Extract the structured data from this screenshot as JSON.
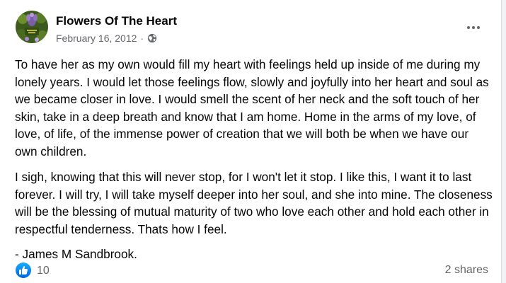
{
  "post": {
    "author": "Flowers Of The Heart",
    "avatar_text": "Flowers Of The Heart",
    "date": "February 16, 2012",
    "separator": "·",
    "privacy_icon": "globe-icon",
    "more_icon": "more-options-icon",
    "paragraphs": [
      "To have her as my own would fill my heart with feelings held up inside of me during my lonely years. I would let those feelings flow, slowly and joyfully into her heart and soul as we became closer in love. I would smell the scent of her neck and the soft touch of her skin, take in a deep breath and know that I am home. Home in the arms of my love, of love, of life, of the immense power of creation that we will both be when we have our own children.",
      "I sigh, knowing that this will never stop, for I won't let it stop. I like this, I want it to last forever. I will try, I will take myself deeper into her soul, and she into mine. The closeness will be the blessing of mutual maturity of two who love each other and hold each other in respectful tenderness. Thats how I feel.",
      "- James M Sandbrook."
    ],
    "reactions": {
      "icon": "like-icon",
      "count": "10"
    },
    "shares": "2 shares"
  },
  "colors": {
    "like_blue": "#1877f2",
    "secondary_text": "#65676b",
    "primary_text": "#050505"
  }
}
